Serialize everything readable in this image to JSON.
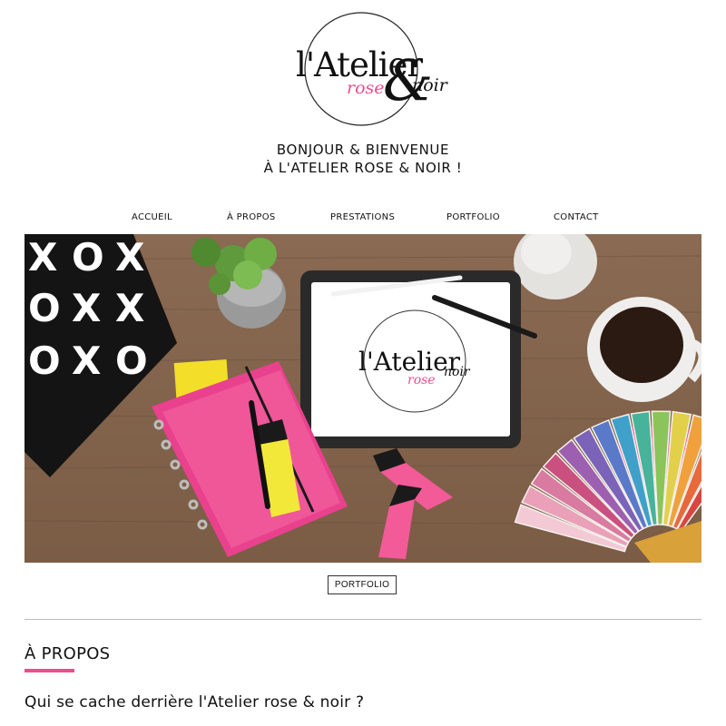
{
  "logo": {
    "brand_text": "l'Atelier",
    "amp_text": "&",
    "rose_text": "rose",
    "noir_text": "noir",
    "accent_color": "#e94f8e"
  },
  "headline": {
    "line1": "BONJOUR & BIENVENUE",
    "line2": "À L'ATELIER ROSE & NOIR !"
  },
  "nav": {
    "items": [
      {
        "label": "ACCUEIL"
      },
      {
        "label": "À PROPOS"
      },
      {
        "label": "PRESTATIONS"
      },
      {
        "label": "PORTFOLIO"
      },
      {
        "label": "CONTACT"
      }
    ]
  },
  "hero": {
    "tablet_brand": "l'Atelier",
    "tablet_rose": "rose",
    "tablet_noir": "noir",
    "ttt_marks": [
      "X",
      "O",
      "X",
      "O",
      "X",
      "X",
      "O",
      "X",
      "O"
    ]
  },
  "portfolio_button": {
    "label": "PORTFOLIO"
  },
  "about": {
    "title": "À PROPOS",
    "subtitle": "Qui se cache derrière l'Atelier rose & noir ?"
  }
}
